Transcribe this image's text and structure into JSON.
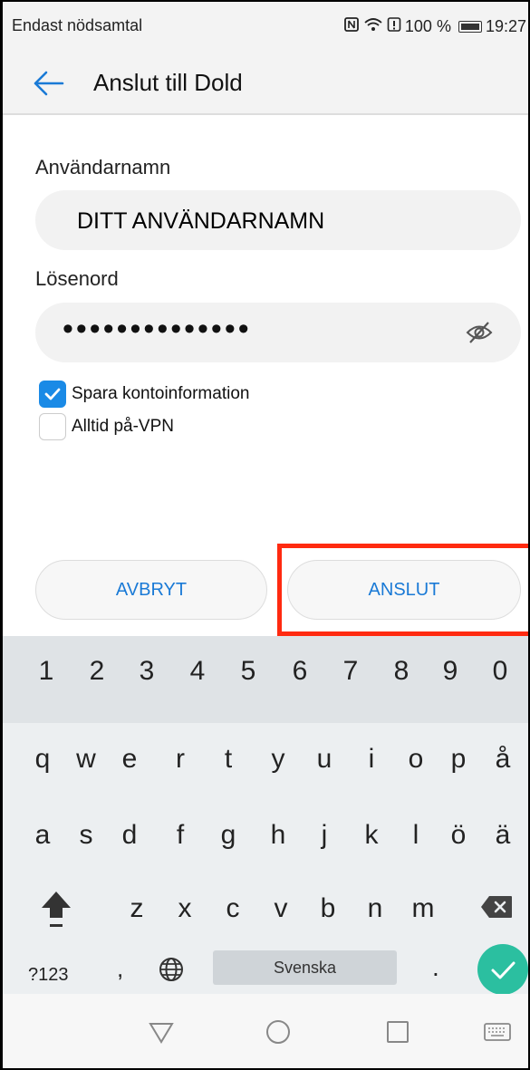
{
  "status_bar": {
    "carrier_text": "Endast nödsamtal",
    "battery_percent": "100 %",
    "time": "19:27",
    "icons": [
      "nfc-icon",
      "wifi-icon",
      "alert-icon",
      "battery-icon"
    ]
  },
  "app_bar": {
    "title": "Anslut till Dold"
  },
  "form": {
    "username_label": "Användarnamn",
    "username_value": "DITT ANVÄNDARNAMN",
    "password_label": "Lösenord",
    "password_value": "••••••••••••••",
    "save_account_label": "Spara kontoinformation",
    "save_account_checked": true,
    "always_on_vpn_label": "Alltid på-VPN",
    "always_on_vpn_checked": false
  },
  "buttons": {
    "cancel_label": "AVBRYT",
    "connect_label": "ANSLUT"
  },
  "keyboard": {
    "number_row": [
      "1",
      "2",
      "3",
      "4",
      "5",
      "6",
      "7",
      "8",
      "9",
      "0"
    ],
    "row_q": [
      "q",
      "w",
      "e",
      "r",
      "t",
      "y",
      "u",
      "i",
      "o",
      "p",
      "å"
    ],
    "row_a": [
      "a",
      "s",
      "d",
      "f",
      "g",
      "h",
      "j",
      "k",
      "l",
      "ö",
      "ä"
    ],
    "row_z": [
      "z",
      "x",
      "c",
      "v",
      "b",
      "n",
      "m"
    ],
    "mode_key": "?123",
    "comma_key": ",",
    "space_label": "Svenska",
    "period_key": "."
  },
  "colors": {
    "accent": "#1a7ad6",
    "highlight": "#ff2a10",
    "enter_key": "#2bbfa0"
  }
}
